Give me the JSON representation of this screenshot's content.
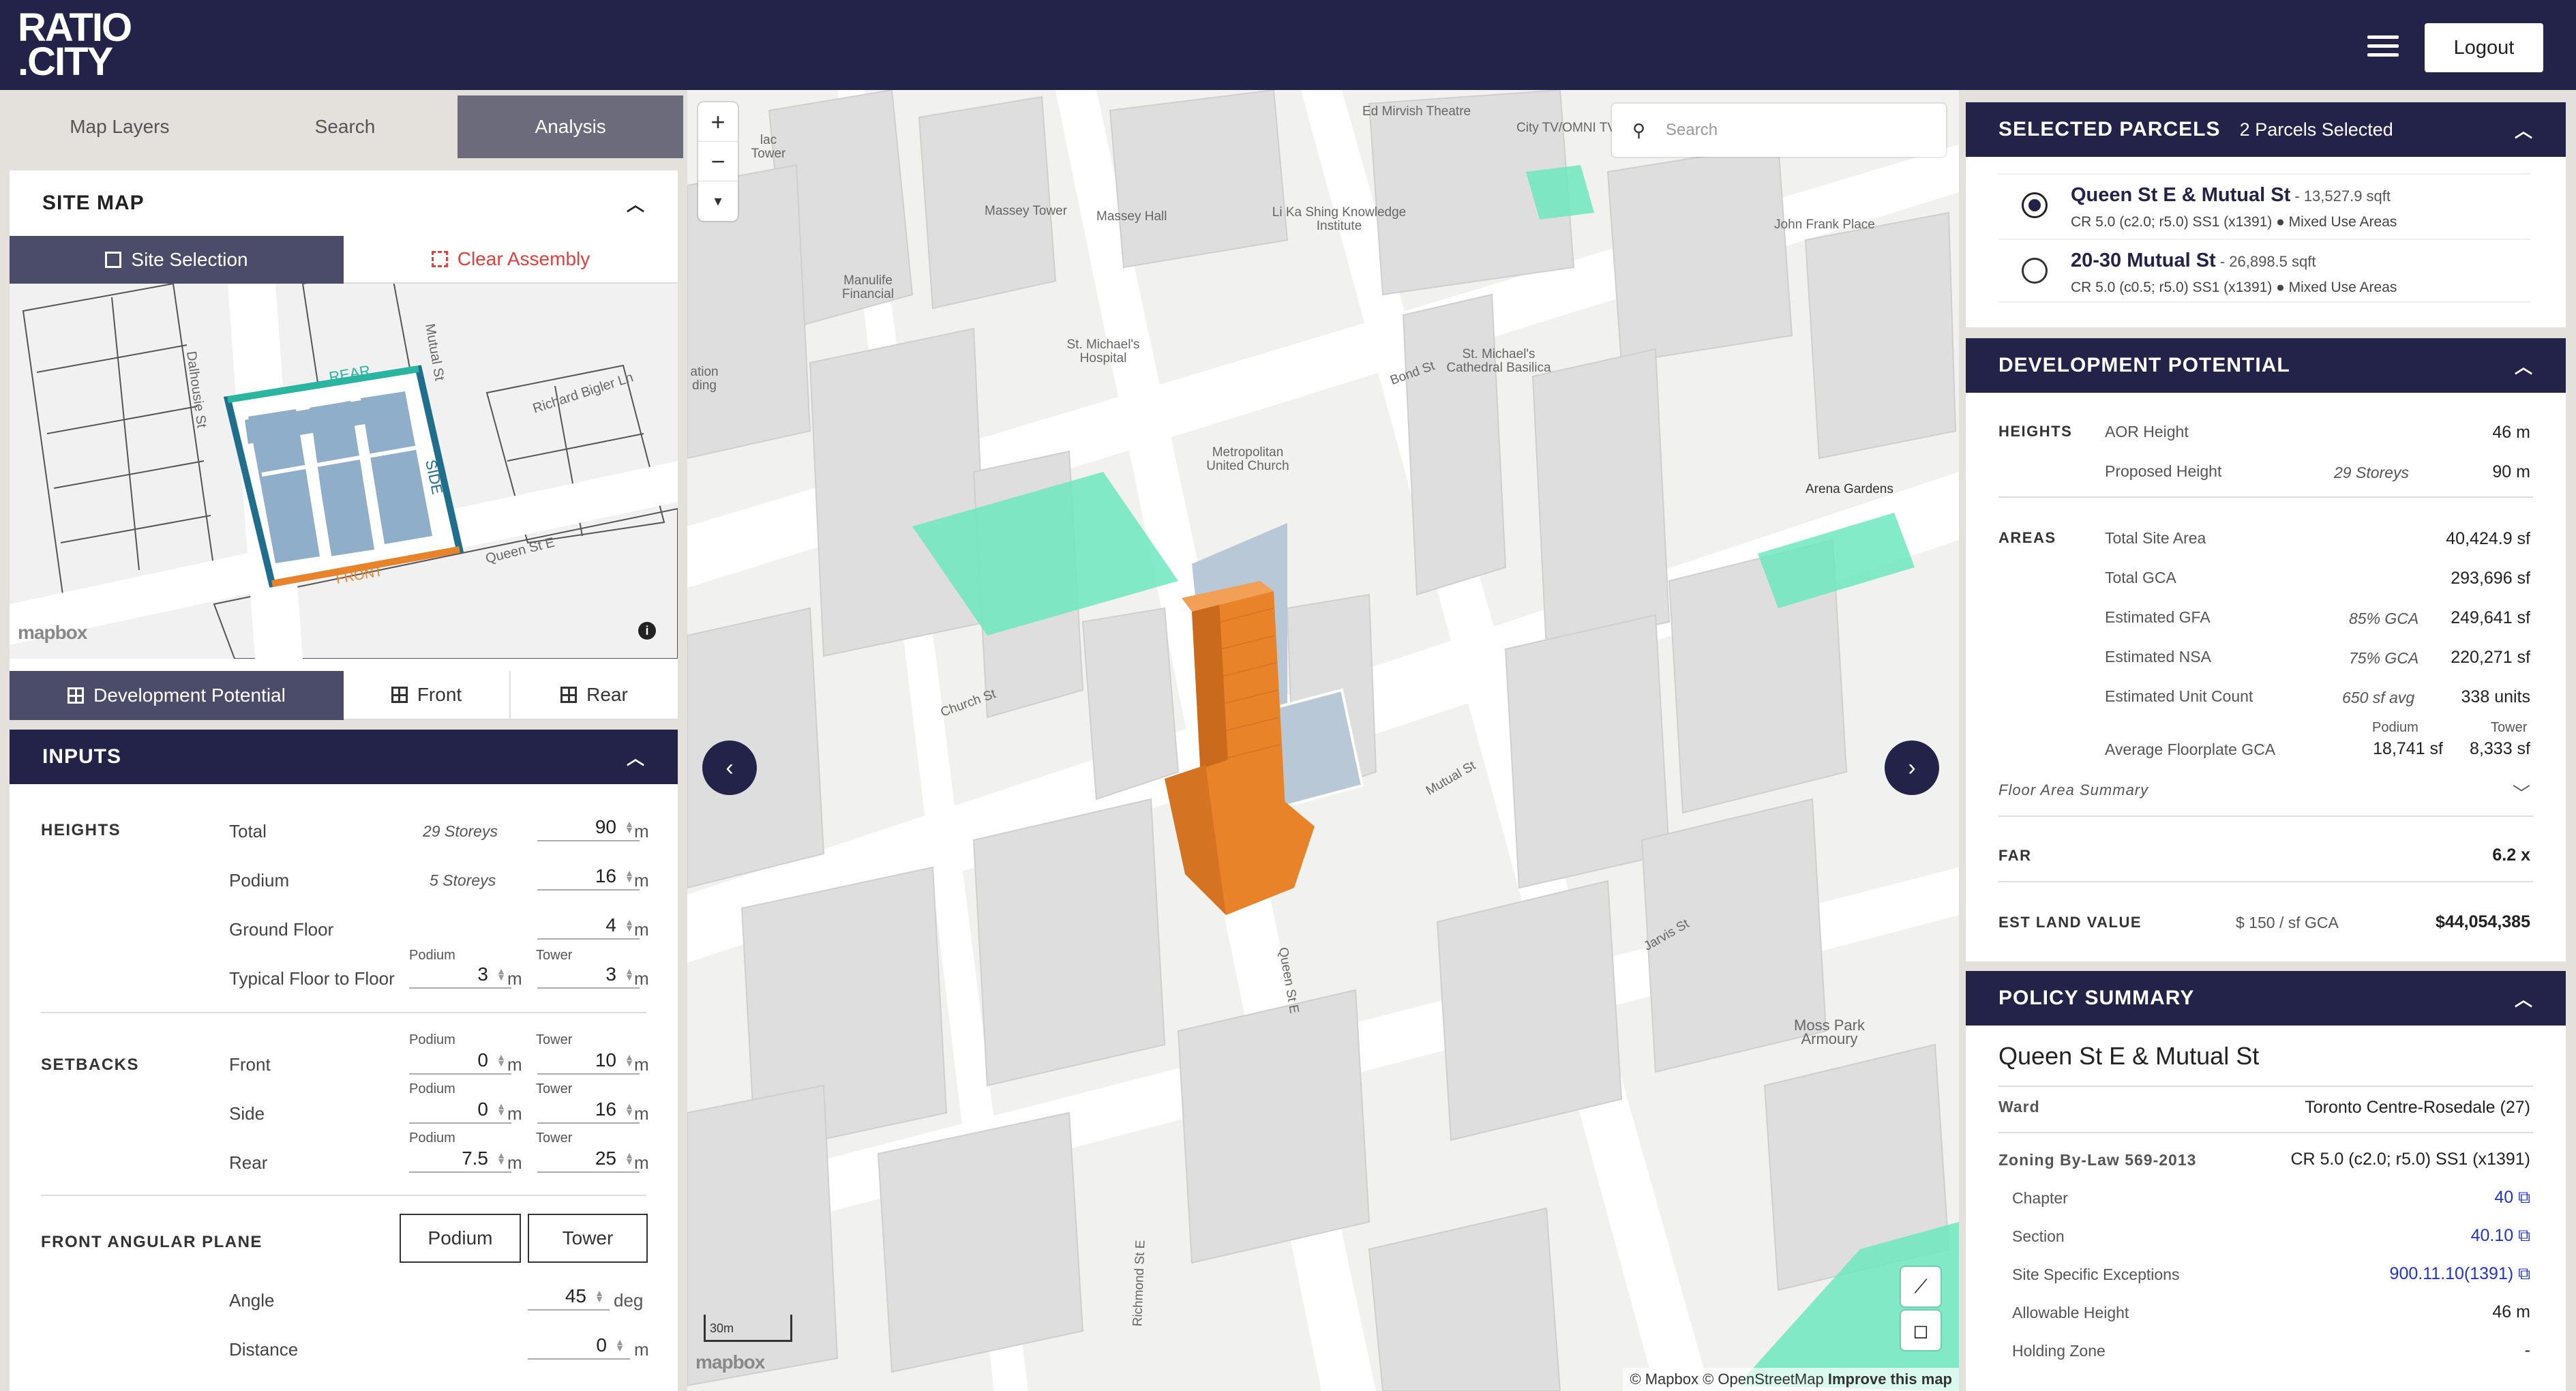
{
  "app": {
    "logo_line1": "RATIO",
    "logo_line2": ".CITY",
    "logout_label": "Logout"
  },
  "left_tabs": [
    "Map Layers",
    "Search",
    "Analysis"
  ],
  "site_map": {
    "title": "SITE MAP",
    "site_selection_label": "Site Selection",
    "clear_assembly_label": "Clear Assembly",
    "labels": {
      "rear": "REAR",
      "side": "SIDE",
      "front": "FRONT",
      "dalhousie": "Dalhousie St",
      "mutual": "Mutual St",
      "richard": "Richard Bigler Ln",
      "queen": "Queen St E"
    },
    "mapbox": "mapbox"
  },
  "view_buttons": [
    "Development Potential",
    "Front",
    "Rear"
  ],
  "inputs": {
    "title": "INPUTS",
    "heights_title": "HEIGHTS",
    "total_label": "Total",
    "total_storeys": "29 Storeys",
    "total_value": "90",
    "unit_m": "m",
    "podium_label": "Podium",
    "podium_storeys": "5 Storeys",
    "podium_value": "16",
    "ground_label": "Ground Floor",
    "ground_value": "4",
    "typical_label": "Typical Floor to Floor",
    "sub_podium": "Podium",
    "sub_tower": "Tower",
    "typical_podium": "3",
    "typical_tower": "3",
    "setbacks_title": "SETBACKS",
    "front_label": "Front",
    "front_podium": "0",
    "front_tower": "10",
    "side_label": "Side",
    "side_podium": "0",
    "side_tower": "16",
    "rear_label": "Rear",
    "rear_podium": "7.5",
    "rear_tower": "25",
    "fap_title": "FRONT ANGULAR PLANE",
    "fap_podium": "Podium",
    "fap_tower": "Tower",
    "angle_label": "Angle",
    "angle_value": "45",
    "unit_deg": "deg",
    "distance_label": "Distance",
    "distance_value": "0"
  },
  "map": {
    "search_placeholder": "Search",
    "attribution": "© Mapbox © OpenStreetMap",
    "improve": "Improve this map",
    "scale": "30m",
    "mapbox": "mapbox",
    "labels": [
      "Ed Mirvish Theatre",
      "City TV/OMNI TV",
      "Massey Tower",
      "Massey Hall",
      "Li Ka Shing Knowledge Institute",
      "John Frank Place",
      "Manulife Financial",
      "St. Michael's Hospital",
      "St. Michael's Cathedral Basilica",
      "Metropolitan United Church",
      "Arena Gardens",
      "Moss Park Armoury",
      "Queen St E",
      "Mutual St",
      "Jarvis St",
      "Richmond St E",
      "Bond St",
      "Church St",
      "lac Tower",
      "ation ding"
    ]
  },
  "selected_parcels": {
    "title": "SELECTED PARCELS",
    "count": "2 Parcels Selected",
    "items": [
      {
        "name": "Queen St E & Mutual St",
        "area": " - 13,527.9 sqft",
        "zoning": "CR 5.0 (c2.0; r5.0) SS1 (x1391) ● Mixed Use Areas",
        "selected": true
      },
      {
        "name": "20-30 Mutual St",
        "area": " - 26,898.5 sqft",
        "zoning": "CR 5.0 (c0.5; r5.0) SS1 (x1391) ● Mixed Use Areas",
        "selected": false
      }
    ]
  },
  "dev_potential": {
    "title": "DEVELOPMENT POTENTIAL",
    "heights_label": "HEIGHTS",
    "aor_label": "AOR Height",
    "aor_value": "46 m",
    "proposed_label": "Proposed Height",
    "proposed_storeys": "29 Storeys",
    "proposed_value": "90 m",
    "areas_label": "AREAS",
    "tsa_label": "Total Site Area",
    "tsa_value": "40,424.9 sf",
    "gca_label": "Total GCA",
    "gca_value": "293,696 sf",
    "gfa_label": "Estimated GFA",
    "gfa_pct": "85% GCA",
    "gfa_value": "249,641 sf",
    "nsa_label": "Estimated NSA",
    "nsa_pct": "75% GCA",
    "nsa_value": "220,271 sf",
    "unit_label": "Estimated Unit Count",
    "unit_avg": "650 sf avg",
    "unit_value": "338 units",
    "afp_label": "Average Floorplate GCA",
    "afp_podium_h": "Podium",
    "afp_tower_h": "Tower",
    "afp_podium": "18,741 sf",
    "afp_tower": "8,333 sf",
    "fas_label": "Floor Area Summary",
    "far_label": "FAR",
    "far_value": "6.2 x",
    "elv_label": "EST LAND VALUE",
    "elv_rate": "$ 150 / sf GCA",
    "elv_value": "$44,054,385"
  },
  "policy": {
    "title": "POLICY SUMMARY",
    "heading": "Queen St E & Mutual St",
    "ward_label": "Ward",
    "ward_value": "Toronto Centre-Rosedale (27)",
    "zbl_label": "Zoning By-Law 569-2013",
    "zbl_value": "CR 5.0 (c2.0; r5.0) SS1 (x1391)",
    "chapter_label": "Chapter",
    "chapter_value": "40",
    "section_label": "Section",
    "section_value": "40.10",
    "sse_label": "Site Specific Exceptions",
    "sse_value": "900.11.10(1391)",
    "ah_label": "Allowable Height",
    "ah_value": "46 m",
    "hz_label": "Holding Zone",
    "hz_value": "-"
  },
  "colors": {
    "navy": "#23234a",
    "accent_green": "#6ee8c0",
    "building_orange": "#e8832a",
    "link": "#2233cc"
  }
}
